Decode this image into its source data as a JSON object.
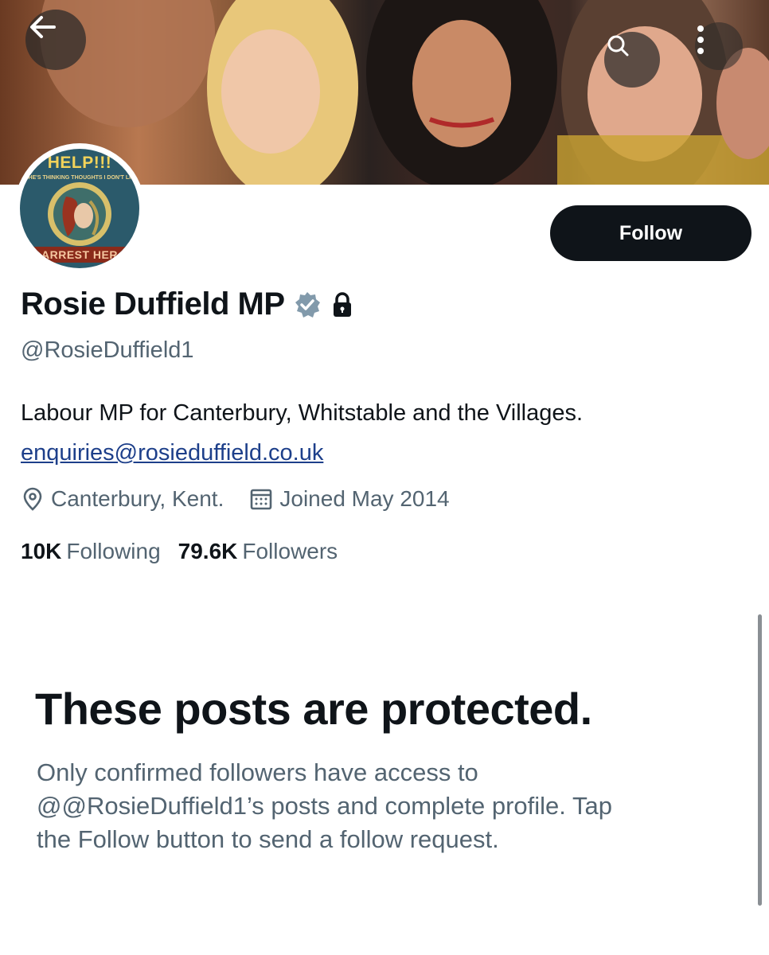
{
  "header": {
    "back_icon": "arrow-left-icon",
    "search_icon": "search-icon",
    "more_icon": "more-vertical-icon"
  },
  "avatar": {
    "top_text": "HELP!!!",
    "sub_text": "SHE'S THINKING THOUGHTS I DON'T LIK",
    "bottom_text": "ARREST HER"
  },
  "profile": {
    "follow_label": "Follow",
    "name": "Rosie Duffield MP",
    "verified_icon": "verified-badge-icon",
    "protected_icon": "lock-icon",
    "handle": "@RosieDuffield1",
    "bio": "Labour MP for Canterbury, Whitstable and the Villages.",
    "email": "enquiries@rosieduffield.co.uk",
    "location": "Canterbury, Kent.",
    "joined": "Joined May 2014",
    "following_count": "10K",
    "following_label": "Following",
    "followers_count": "79.6K",
    "followers_label": "Followers"
  },
  "protected_notice": {
    "title": "These posts are protected.",
    "line1": "Only confirmed followers have access to",
    "line2": "@@RosieDuffield1’s posts and complete profile. Tap",
    "line3": "the Follow button to send a follow request."
  },
  "colors": {
    "text_primary": "#0f1419",
    "text_secondary": "#536471",
    "link": "#1d3f8a",
    "verified": "#829aab"
  }
}
